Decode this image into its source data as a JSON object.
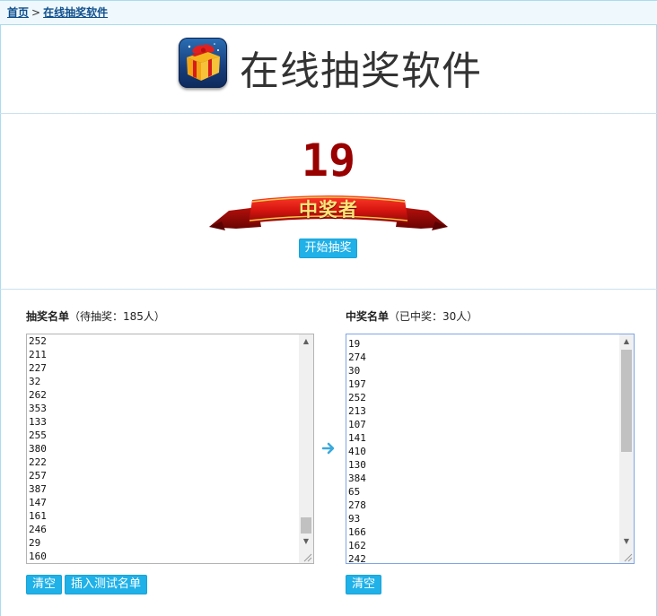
{
  "breadcrumb": {
    "home": "首页",
    "separator": ">",
    "current": "在线抽奖软件"
  },
  "header": {
    "logo_icon": "gift-box-icon",
    "title": "在线抽奖软件"
  },
  "draw": {
    "winner_number": "19",
    "ribbon_label": "中奖者",
    "start_button": "开始抽奖"
  },
  "pending": {
    "title": "抽奖名单",
    "count_text": "（待抽奖：185人）",
    "items": [
      "252",
      "211",
      "227",
      "32",
      "262",
      "353",
      "133",
      "255",
      "380",
      "222",
      "257",
      "387",
      "147",
      "161",
      "246",
      "29",
      "160"
    ],
    "clear_button": "清空",
    "insert_test_button": "插入测试名单"
  },
  "winners": {
    "title": "中奖名单",
    "count_text": "（已中奖：30人）",
    "items": [
      "19",
      "274",
      "30",
      "197",
      "252",
      "213",
      "107",
      "141",
      "410",
      "130",
      "384",
      "65",
      "278",
      "93",
      "166",
      "162",
      "242"
    ],
    "clear_button": "清空"
  },
  "colors": {
    "accent": "#1fb1e8",
    "winner_number": "#990000",
    "ribbon": "#cc1111",
    "breadcrumb_link": "#0f4f8c"
  }
}
